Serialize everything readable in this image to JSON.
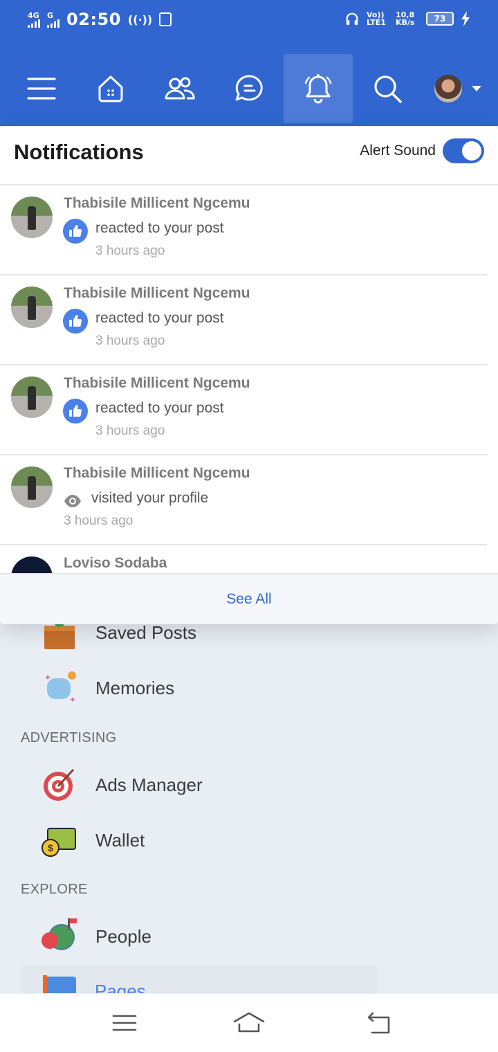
{
  "status_bar": {
    "network1": "4G",
    "network2": "G",
    "time": "02:50",
    "volte": "Vo)) LTE1",
    "speed": "10,8 KB/s",
    "battery": "73"
  },
  "nav": {
    "items": [
      "menu-icon",
      "home-icon",
      "friends-icon",
      "messages-icon",
      "notifications-icon",
      "search-icon",
      "profile-avatar"
    ],
    "active": "notifications-icon"
  },
  "notifications": {
    "title": "Notifications",
    "alert_sound_label": "Alert Sound",
    "alert_sound_on": true,
    "items": [
      {
        "name": "Thabisile Millicent Ngcemu",
        "action": "reacted to your post",
        "time": "3 hours ago",
        "icon": "like-icon"
      },
      {
        "name": "Thabisile Millicent Ngcemu",
        "action": "reacted to your post",
        "time": "3 hours ago",
        "icon": "like-icon"
      },
      {
        "name": "Thabisile Millicent Ngcemu",
        "action": "reacted to your post",
        "time": "3 hours ago",
        "icon": "like-icon"
      },
      {
        "name": "Thabisile Millicent Ngcemu",
        "action": "visited your profile",
        "time": "3 hours ago",
        "icon": "eye-icon"
      },
      {
        "name": "Loviso Sodaba",
        "action": "",
        "time": "",
        "icon": ""
      }
    ],
    "see_all": "See All"
  },
  "menu": {
    "saved_posts": "Saved Posts",
    "memories": "Memories",
    "advertising_header": "ADVERTISING",
    "ads_manager": "Ads Manager",
    "wallet": "Wallet",
    "explore_header": "EXPLORE",
    "people": "People",
    "pages": "Pages"
  },
  "colors": {
    "brand": "#3166d1",
    "like": "#4a80e8"
  }
}
